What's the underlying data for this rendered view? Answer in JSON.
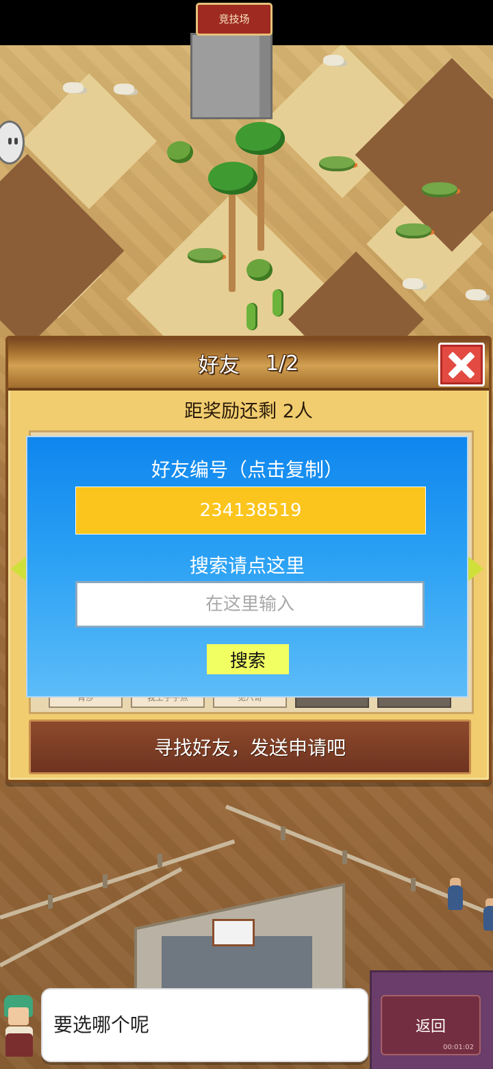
{
  "map": {
    "arena_sign": "竞技场"
  },
  "dialog": {
    "title": "好友",
    "page": "1/2",
    "reward_text": "距奖励还剩 2人",
    "bottom_banner": "寻找好友，发送申请吧",
    "slots": [
      {
        "label": "宵莎",
        "filled": true
      },
      {
        "label": "我王子子点",
        "filled": true
      },
      {
        "label": "见八哥",
        "filled": true
      },
      {
        "label": "",
        "filled": false
      },
      {
        "label": "",
        "filled": false
      }
    ]
  },
  "friend_panel": {
    "id_title": "好友编号（点击复制）",
    "friend_id": "234138519",
    "search_label": "搜索请点这里",
    "search_placeholder": "在这里输入",
    "search_value": "",
    "search_button": "搜索"
  },
  "assistant": {
    "message": "要选哪个呢",
    "back_button": "返回",
    "timer": "00:01:02"
  },
  "colors": {
    "panel_blue_top": "#0f86ee",
    "panel_blue_bottom": "#5cbcf8",
    "id_box_yellow": "#fcc51d",
    "search_button": "#f1ff63",
    "close_red": "#e24a42",
    "dialog_gold": "#f1cd6f",
    "banner_brown": "#6e3320"
  }
}
